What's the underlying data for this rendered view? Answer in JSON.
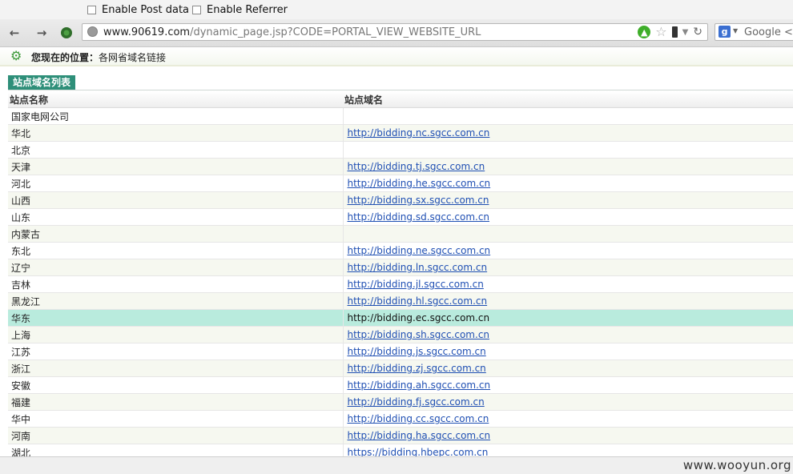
{
  "hackbar": {
    "enable_post_label": "Enable Post data",
    "enable_referrer_label": "Enable Referrer"
  },
  "browser": {
    "url_host": "www.90619.com",
    "url_path": "/dynamic_page.jsp?CODE=PORTAL_VIEW_WEBSITE_URL",
    "search_engine": "Google",
    "search_placeholder": "Google <C",
    "icons": [
      "back-icon",
      "forward-icon",
      "addon-icon",
      "globe-icon",
      "go-icon",
      "star-icon",
      "mobile-icon",
      "dropdown-icon",
      "reload-icon",
      "google-icon"
    ]
  },
  "location": {
    "prefix": "您现在的位置：",
    "path": "各网省域名链接"
  },
  "section": {
    "title": "站点域名列表"
  },
  "table": {
    "headers": [
      "站点名称",
      "站点域名"
    ],
    "rows": [
      {
        "name": "国家电网公司",
        "url": ""
      },
      {
        "name": "华北",
        "url": "http://bidding.nc.sgcc.com.cn"
      },
      {
        "name": "北京",
        "url": ""
      },
      {
        "name": "天津",
        "url": "http://bidding.tj.sgcc.com.cn"
      },
      {
        "name": "河北",
        "url": "http://bidding.he.sgcc.com.cn"
      },
      {
        "name": "山西",
        "url": "http://bidding.sx.sgcc.com.cn"
      },
      {
        "name": "山东",
        "url": "http://bidding.sd.sgcc.com.cn"
      },
      {
        "name": "内蒙古",
        "url": ""
      },
      {
        "name": "东北",
        "url": "http://bidding.ne.sgcc.com.cn"
      },
      {
        "name": "辽宁",
        "url": "http://bidding.ln.sgcc.com.cn"
      },
      {
        "name": "吉林",
        "url": "http://bidding.jl.sgcc.com.cn"
      },
      {
        "name": "黑龙江",
        "url": "http://bidding.hl.sgcc.com.cn"
      },
      {
        "name": "华东",
        "url": "http://bidding.ec.sgcc.com.cn",
        "highlighted": true
      },
      {
        "name": "上海",
        "url": "http://bidding.sh.sgcc.com.cn"
      },
      {
        "name": "江苏",
        "url": "http://bidding.js.sgcc.com.cn"
      },
      {
        "name": "浙江",
        "url": "http://bidding.zj.sgcc.com.cn"
      },
      {
        "name": "安徽",
        "url": "http://bidding.ah.sgcc.com.cn"
      },
      {
        "name": "福建",
        "url": "http://bidding.fj.sgcc.com.cn"
      },
      {
        "name": "华中",
        "url": "http://bidding.cc.sgcc.com.cn"
      },
      {
        "name": "河南",
        "url": "http://bidding.ha.sgcc.com.cn"
      },
      {
        "name": "湖北",
        "url": "https://bidding.hbepc.com.cn"
      }
    ]
  },
  "watermark": "www.wooyun.org",
  "colors": {
    "section_tab": "#2e8f79",
    "row_highlight": "#b9ebdd",
    "link": "#1f4fb3"
  }
}
